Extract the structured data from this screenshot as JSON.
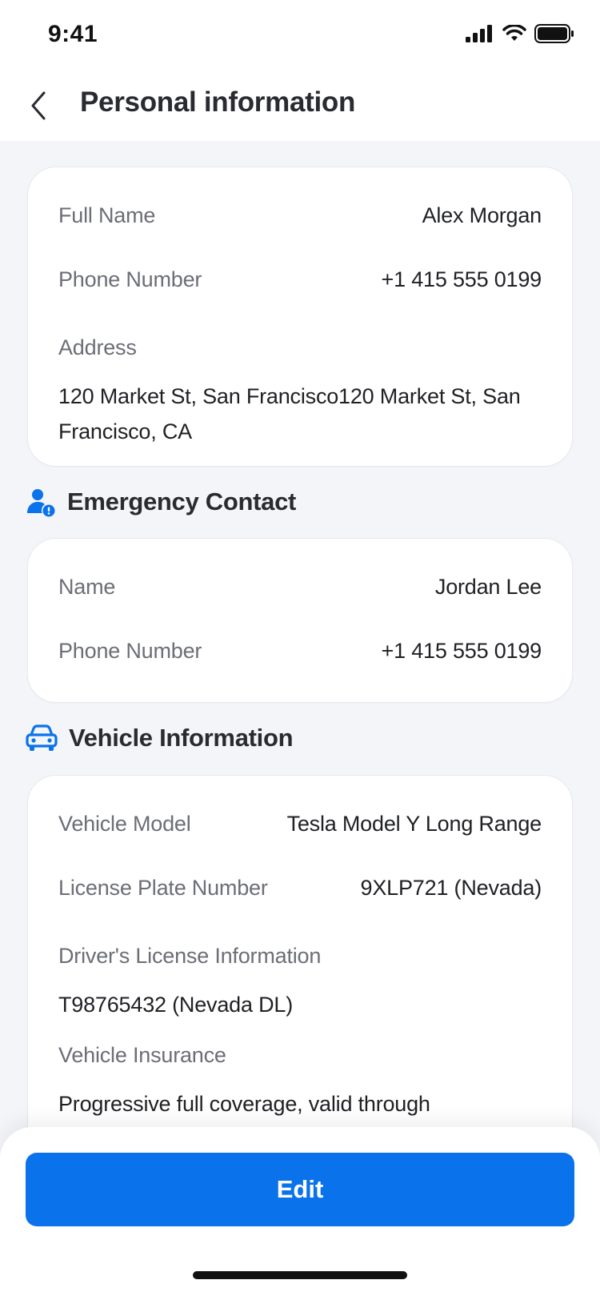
{
  "status_bar": {
    "time": "9:41"
  },
  "header": {
    "title": "Personal information"
  },
  "personal": {
    "full_name_label": "Full Name",
    "full_name_value": "Alex Morgan",
    "phone_label": "Phone Number",
    "phone_value": "+1 415 555 0199",
    "address_label": "Address",
    "address_value": "120 Market St, San Francisco120 Market St, San Francisco, CA"
  },
  "emergency": {
    "section_title": "Emergency Contact",
    "icon": "person-alert-icon",
    "name_label": "Name",
    "name_value": "Jordan Lee",
    "phone_label": "Phone Number",
    "phone_value": "+1 415 555 0199"
  },
  "vehicle": {
    "section_title": "Vehicle Information",
    "icon": "car-icon",
    "model_label": "Vehicle Model",
    "model_value": "Tesla Model Y Long Range",
    "plate_label": "License Plate Number",
    "plate_value": "9XLP721 (Nevada)",
    "license_label": "Driver's License Information",
    "license_value": "T98765432 (Nevada DL)",
    "insurance_label": "Vehicle Insurance",
    "insurance_value": "Progressive full coverage, valid through"
  },
  "actions": {
    "edit_label": "Edit"
  },
  "colors": {
    "accent": "#0a72ea",
    "background": "#f3f5f9",
    "card": "#ffffff"
  }
}
